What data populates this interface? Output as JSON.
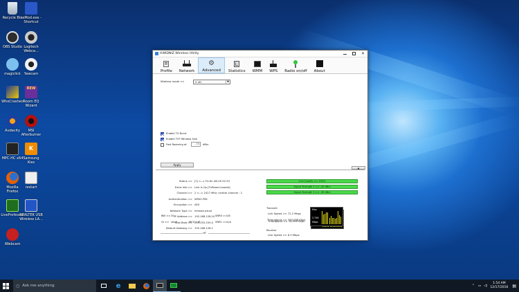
{
  "desktop": {
    "icons": [
      {
        "label": "Recycle Bin",
        "sub": "",
        "color": "#c9d4dc"
      },
      {
        "label": "ssMod.exe -",
        "sub": "Shortcut",
        "color": "#2a58c8"
      },
      {
        "label": "OBS Studio",
        "sub": "",
        "color": "#3b3b3b"
      },
      {
        "label": "Logitech",
        "sub": "Webca...",
        "color": "#d0d0d0"
      },
      {
        "label": "magiclick",
        "sub": "",
        "color": "#6fb4e8"
      },
      {
        "label": "Yawcam",
        "sub": "",
        "color": "#f2f2f2"
      },
      {
        "label": "WhoCrashed",
        "sub": "",
        "color": "#f3c600"
      },
      {
        "label": "Room EQ",
        "sub": "Wizard",
        "color": "#6b2f9c"
      },
      {
        "label": "Audacity",
        "sub": "",
        "color": "#e74c1a"
      },
      {
        "label": "MSI",
        "sub": "Afterburner",
        "color": "#b31010"
      },
      {
        "label": "MPC-HC x64",
        "sub": "",
        "color": "#2b2b2b"
      },
      {
        "label": "Samsung",
        "sub": "Kies",
        "color": "#f08c00"
      },
      {
        "label": "Mozilla",
        "sub": "Firefox",
        "color": "#e66000"
      },
      {
        "label": "restart",
        "sub": "",
        "color": "#efefef"
      },
      {
        "label": "LiveProfessor",
        "sub": "",
        "color": "#1f6e1f"
      },
      {
        "label": "REALTEK USB",
        "sub": "Wireless LA...",
        "color": "#2355c7"
      },
      {
        "label": "iWebcam",
        "sub": "",
        "color": "#c62020"
      }
    ]
  },
  "window": {
    "title": "HWIDNIZ Wireless Utility",
    "toolbar": [
      "Profile",
      "Network",
      "Advanced",
      "Statistics",
      "WMM",
      "WPS",
      "Radio on/off",
      "About"
    ],
    "active_tab": "Advanced"
  },
  "advanced": {
    "wireless_mode_label": "Wireless mode >>",
    "wireless_mode_value": "2.4G",
    "enable_tx_burst": "Enable TX Burst",
    "enable_tcp_window": "Enable TCP Window Size",
    "fast_roaming": "Fast Roaming at",
    "fast_roaming_value": "-70",
    "fast_roaming_unit": "dBm",
    "apply": "Apply",
    "collapse_arrow": "▲"
  },
  "status": {
    "rows": [
      {
        "label": "Status >>",
        "value": "[?] <--> F4-6C-4B-2E-52-53"
      },
      {
        "label": "Extra Info >>",
        "value": "Link is Up [TxPower:Lowest]"
      },
      {
        "label": "Channel >>",
        "value": "2 <--> 2417 MHz; central channel : 2"
      },
      {
        "label": "Authentication >>",
        "value": "WPA2-PSK"
      },
      {
        "label": "Encryption >>",
        "value": "AES"
      },
      {
        "label": "Network Type >>",
        "value": "Infrastructure"
      },
      {
        "label": "IP Address >>",
        "value": "192.168.128.10"
      },
      {
        "label": "Sub Mask >>",
        "value": "255.255.255.0"
      },
      {
        "label": "Default Gateway >>",
        "value": "192.168.128.1"
      }
    ],
    "ht_label": "HT",
    "ht": {
      "bw_label": "BW >>",
      "bw_value": "20",
      "gi_label": "GI >>",
      "gi_value": "short",
      "mcs_label": "MCS >>",
      "mcs_value": "7",
      "snr0_label": "SNR0 >>",
      "snr0_value": "28",
      "snr1_label": "SNR1 >>",
      "snr1_value": "n/a"
    }
  },
  "signal": {
    "link_quality": "Link Quality >> 100%",
    "strength1": "Signal Strength 1 >> -40 dBm",
    "strength2": "Signal Strength 2 >> -36 dBm",
    "link_quality_pct": 100
  },
  "transmit": {
    "title": "Transmit",
    "link_speed": "Link Speed >>  72.2 Mbps",
    "throughput": "Throughput >> 18.096 Kbps",
    "graph_max": "Max",
    "graph_value": "128.931",
    "graph_unit": "Kbps"
  },
  "receive": {
    "title": "Receive",
    "link_speed": "Link Speed >> 6.5 Mbps",
    "throughput": "Throughput >> 493.008 Kbps",
    "graph_max": "Max",
    "graph_value": "3.758",
    "graph_unit": "Mbps"
  },
  "taskbar": {
    "search_placeholder": "Ask me anything",
    "time": "1:54 AM",
    "date": "12/17/2016"
  }
}
